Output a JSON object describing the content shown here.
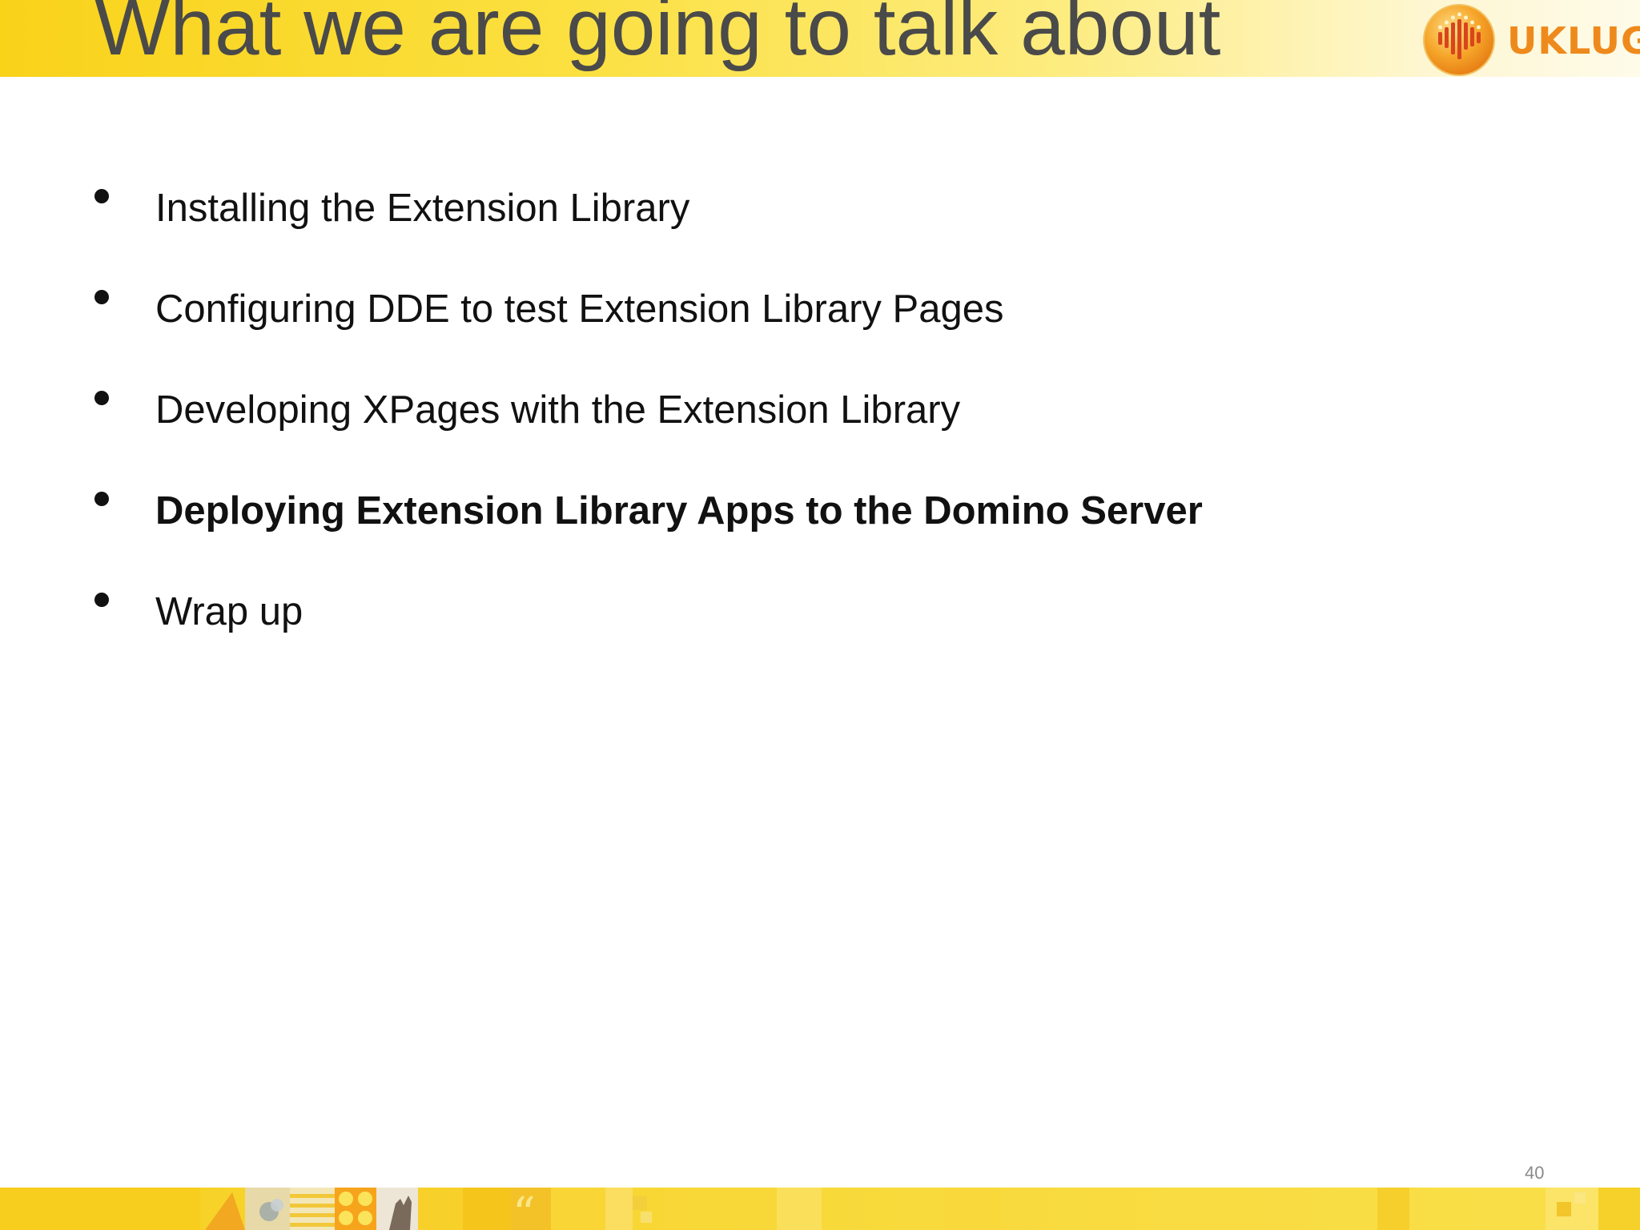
{
  "slide": {
    "title": "What we are going to talk about",
    "logo_text": "UKLUG",
    "page_number": "40"
  },
  "bullets": [
    {
      "text": "Installing the Extension Library",
      "bold": false
    },
    {
      "text": "Configuring DDE to test Extension Library Pages",
      "bold": false
    },
    {
      "text": "Developing XPages with the Extension Library",
      "bold": false
    },
    {
      "text": "Deploying Extension Library Apps to the Domino Server",
      "bold": true
    },
    {
      "text": "Wrap up",
      "bold": false
    }
  ],
  "colors": {
    "title_band": "#f9d21a",
    "title_text": "#4a4a4a",
    "logo_orange": "#ee8a1c",
    "footer_band": "#f7cf22",
    "page_number": "#8a8a8a"
  },
  "icons": [
    "uklug-logo-icon",
    "quote-mark-icon",
    "hand-icon",
    "dots-pattern-icon",
    "stripes-pattern-icon"
  ]
}
